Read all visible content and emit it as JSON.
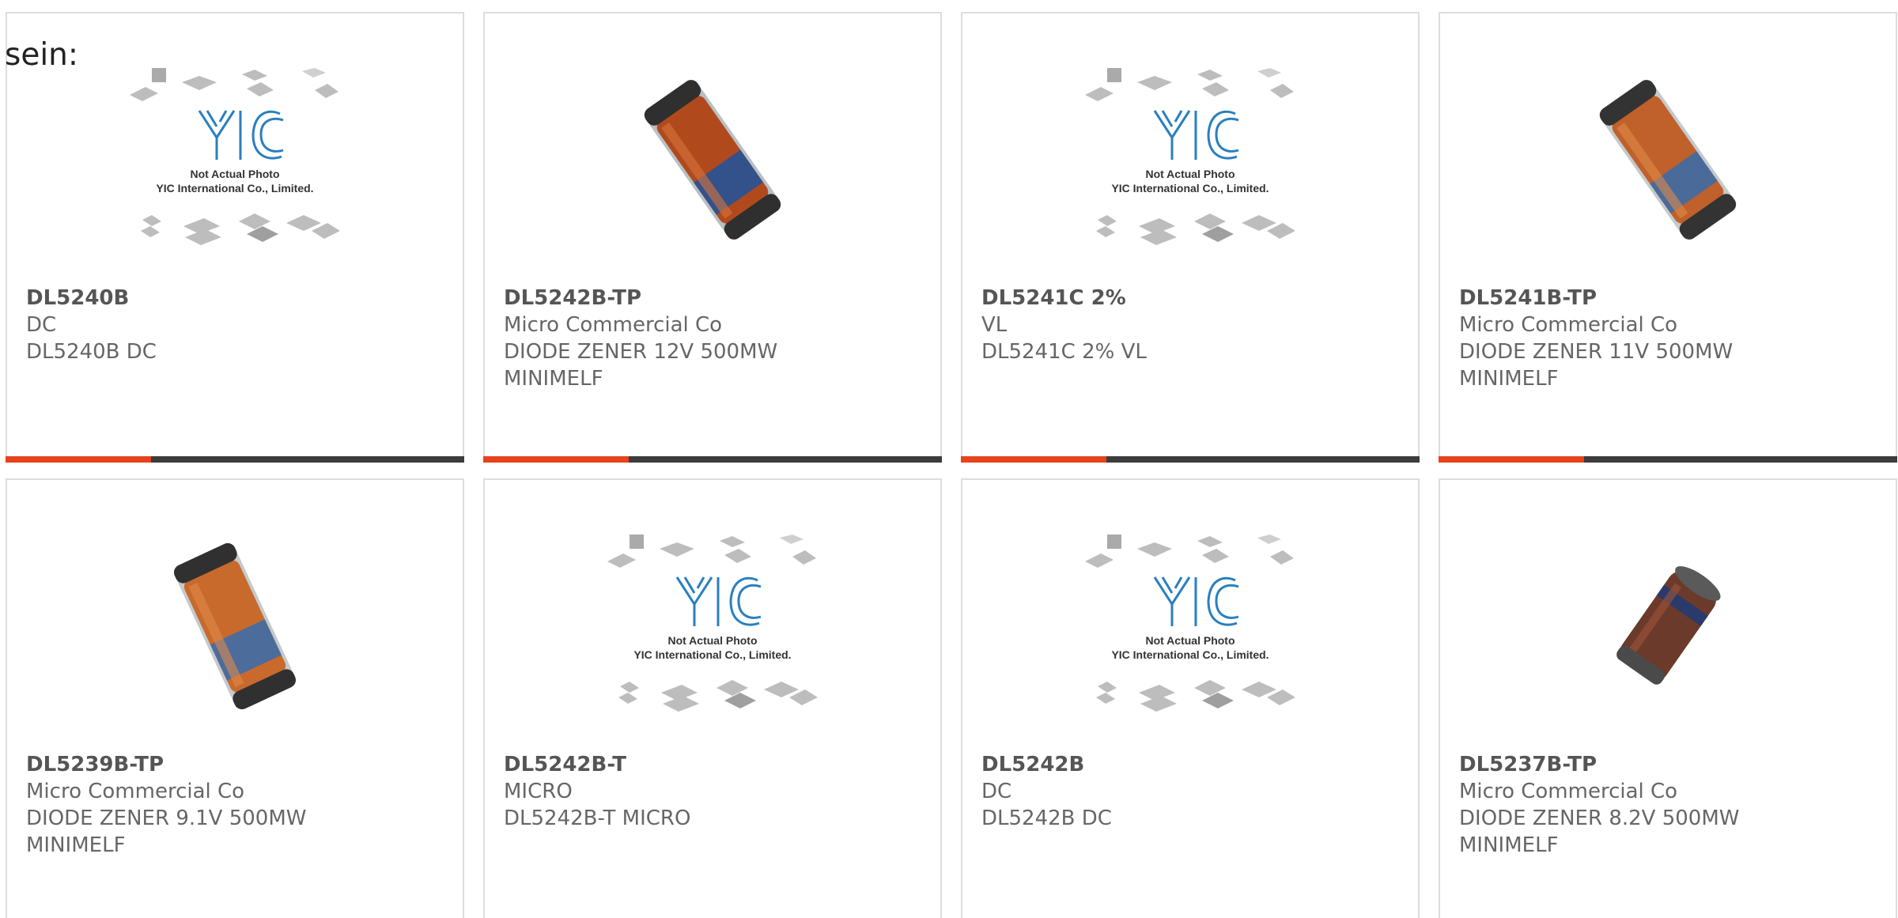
{
  "heading": "sein:",
  "colors": {
    "accent": "#e8421c",
    "bar": "#3c3c3c",
    "border": "#dddddd",
    "text": "#666666"
  },
  "placeholder": {
    "line1": "Not Actual Photo",
    "line2": "YIC International Co., Limited."
  },
  "products": [
    {
      "part": "DL5240B",
      "maker": "DC",
      "desc1": "DL5240B DC",
      "desc2": "",
      "image": "placeholder-logo"
    },
    {
      "part": "DL5242B-TP",
      "maker": "Micro Commercial Co",
      "desc1": "DIODE ZENER 12V 500MW",
      "desc2": "MINIMELF",
      "image": "minimelf-photo"
    },
    {
      "part": "DL5241C 2%",
      "maker": "VL",
      "desc1": "DL5241C 2% VL",
      "desc2": "",
      "image": "placeholder-logo"
    },
    {
      "part": "DL5241B-TP",
      "maker": "Micro Commercial Co",
      "desc1": "DIODE ZENER 11V 500MW",
      "desc2": "MINIMELF",
      "image": "minimelf-photo"
    },
    {
      "part": "DL5239B-TP",
      "maker": "Micro Commercial Co",
      "desc1": "DIODE ZENER 9.1V 500MW",
      "desc2": "MINIMELF",
      "image": "minimelf-photo"
    },
    {
      "part": "DL5242B-T",
      "maker": "MICRO",
      "desc1": "DL5242B-T MICRO",
      "desc2": "",
      "image": "placeholder-logo"
    },
    {
      "part": "DL5242B",
      "maker": "DC",
      "desc1": "DL5242B DC",
      "desc2": "",
      "image": "placeholder-logo"
    },
    {
      "part": "DL5237B-TP",
      "maker": "Micro Commercial Co",
      "desc1": "DIODE ZENER 8.2V 500MW",
      "desc2": "MINIMELF",
      "image": "melf-dark-photo"
    }
  ]
}
